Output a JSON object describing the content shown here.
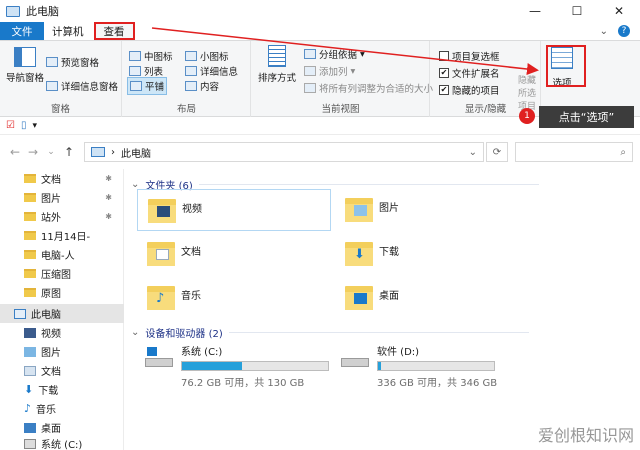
{
  "window": {
    "title": "此电脑",
    "controls": [
      "—",
      "☐",
      "✕"
    ]
  },
  "tabs": {
    "file": "文件",
    "computer": "计算机",
    "view": "查看"
  },
  "ribbon": {
    "pane_group": {
      "label": "窗格",
      "nav_pane": "导航窗格",
      "preview_pane": "预览窗格",
      "details_pane": "详细信息窗格"
    },
    "layout_group": {
      "label": "布局",
      "items": [
        "中图标",
        "小图标",
        "列表",
        "详细信息",
        "平铺",
        "内容"
      ]
    },
    "current_view_group": {
      "label": "当前视图",
      "sort": "排序方式",
      "group_by": "分组依据",
      "add_column": "添加列",
      "fit_columns": "将所有列调整为合适的大小"
    },
    "show_hide_group": {
      "label": "显示/隐藏",
      "item_checkbox": "项目复选框",
      "file_ext": "文件扩展名",
      "hidden_items": "隐藏的项目",
      "hide": "隐藏",
      "hide_selected": "所选项目",
      "checks": {
        "item_checkbox": false,
        "file_ext": true,
        "hidden_items": true
      }
    },
    "options": "选项"
  },
  "address": {
    "path": "此电脑",
    "separator": "›"
  },
  "sidebar": {
    "items": [
      {
        "label": "文档",
        "pinned": true
      },
      {
        "label": "图片",
        "pinned": true
      },
      {
        "label": "站外",
        "pinned": true
      },
      {
        "label": "11月14日-",
        "pinned": false
      },
      {
        "label": "电脑-人",
        "pinned": false
      },
      {
        "label": "压缩图",
        "pinned": false
      },
      {
        "label": "原图",
        "pinned": false
      },
      {
        "label": "此电脑",
        "pinned": false
      },
      {
        "label": "视频",
        "pinned": false
      },
      {
        "label": "图片",
        "pinned": false
      },
      {
        "label": "文档",
        "pinned": false
      },
      {
        "label": "下载",
        "pinned": false
      },
      {
        "label": "音乐",
        "pinned": false
      },
      {
        "label": "桌面",
        "pinned": false
      },
      {
        "label": "系统 (C:)",
        "pinned": false
      }
    ]
  },
  "main": {
    "folders_header": "文件夹 (6)",
    "folders": [
      "视频",
      "图片",
      "文档",
      "下载",
      "音乐",
      "桌面"
    ],
    "drives_header": "设备和驱动器 (2)",
    "drives": [
      {
        "name": "系统 (C:)",
        "free": "76.2 GB 可用，共 130 GB",
        "used_fraction": 0.41
      },
      {
        "name": "软件 (D:)",
        "free": "336 GB 可用，共 346 GB",
        "used_fraction": 0.03
      }
    ]
  },
  "annotation": {
    "number": "1",
    "text": "点击“选项”"
  },
  "watermark": "爱创根知识网",
  "colors": {
    "accent": "#1979ca",
    "highlight": "#e02020"
  }
}
